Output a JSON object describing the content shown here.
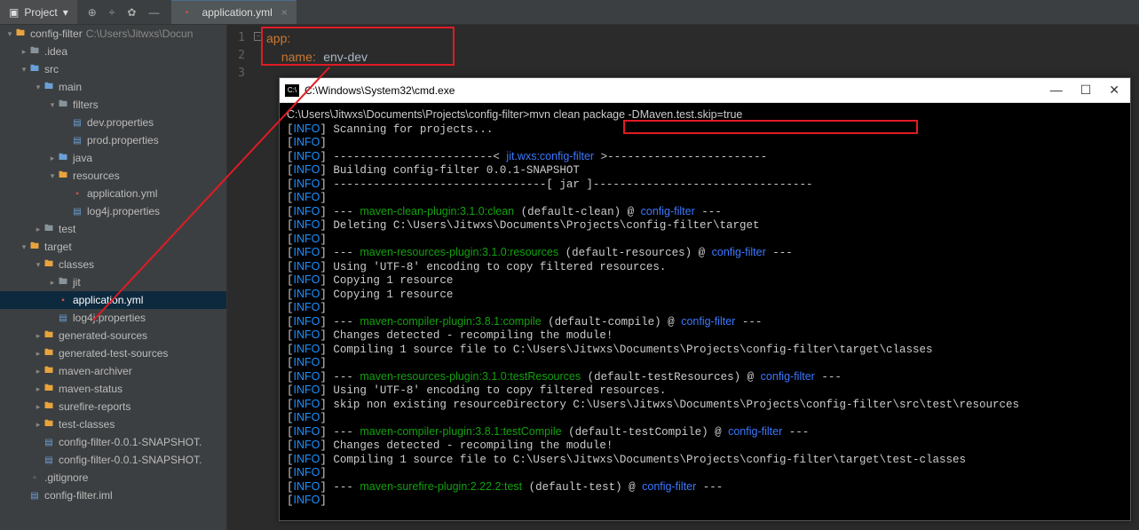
{
  "top": {
    "project": "Project",
    "tab": "application.yml"
  },
  "tree": [
    {
      "d": 0,
      "a": "▾",
      "ic": "dir-m",
      "t": "config-filter",
      "path": "C:\\Users\\Jitwxs\\Docun"
    },
    {
      "d": 1,
      "a": "▸",
      "ic": "dir",
      "t": ".idea"
    },
    {
      "d": 1,
      "a": "▾",
      "ic": "dir-b",
      "t": "src"
    },
    {
      "d": 2,
      "a": "▾",
      "ic": "dir-b",
      "t": "main"
    },
    {
      "d": 3,
      "a": "▾",
      "ic": "dir",
      "t": "filters"
    },
    {
      "d": 4,
      "a": "",
      "ic": "prop",
      "t": "dev.properties"
    },
    {
      "d": 4,
      "a": "",
      "ic": "prop",
      "t": "prod.properties"
    },
    {
      "d": 3,
      "a": "▸",
      "ic": "dir-b",
      "t": "java"
    },
    {
      "d": 3,
      "a": "▾",
      "ic": "dir-m",
      "t": "resources"
    },
    {
      "d": 4,
      "a": "",
      "ic": "yml",
      "t": "application.yml"
    },
    {
      "d": 4,
      "a": "",
      "ic": "prop",
      "t": "log4j.properties"
    },
    {
      "d": 2,
      "a": "▸",
      "ic": "dir",
      "t": "test"
    },
    {
      "d": 1,
      "a": "▾",
      "ic": "dir-m",
      "t": "target"
    },
    {
      "d": 2,
      "a": "▾",
      "ic": "dir-m",
      "t": "classes"
    },
    {
      "d": 3,
      "a": "▸",
      "ic": "dir",
      "t": "jit"
    },
    {
      "d": 3,
      "a": "",
      "ic": "yml",
      "t": "application.yml",
      "sel": true
    },
    {
      "d": 3,
      "a": "",
      "ic": "prop",
      "t": "log4j.properties"
    },
    {
      "d": 2,
      "a": "▸",
      "ic": "dir-m",
      "t": "generated-sources"
    },
    {
      "d": 2,
      "a": "▸",
      "ic": "dir-m",
      "t": "generated-test-sources"
    },
    {
      "d": 2,
      "a": "▸",
      "ic": "dir-m",
      "t": "maven-archiver"
    },
    {
      "d": 2,
      "a": "▸",
      "ic": "dir-m",
      "t": "maven-status"
    },
    {
      "d": 2,
      "a": "▸",
      "ic": "dir-m",
      "t": "surefire-reports"
    },
    {
      "d": 2,
      "a": "▸",
      "ic": "dir-m",
      "t": "test-classes"
    },
    {
      "d": 2,
      "a": "",
      "ic": "prop",
      "t": "config-filter-0.0.1-SNAPSHOT."
    },
    {
      "d": 2,
      "a": "",
      "ic": "prop",
      "t": "config-filter-0.0.1-SNAPSHOT."
    },
    {
      "d": 1,
      "a": "",
      "ic": "file",
      "t": ".gitignore"
    },
    {
      "d": 1,
      "a": "",
      "ic": "prop",
      "t": "config-filter.iml"
    }
  ],
  "code": {
    "k1": "app",
    "k2": "name",
    "v": "env-dev"
  },
  "cmd_title": "C:\\Windows\\System32\\cmd.exe",
  "cmd_prompt": "C:\\Users\\Jitwxs\\Documents\\Projects\\config-filter>",
  "cmd_cmd": "mvn clean package -DMaven.test.skip=true",
  "L": {
    "scan": "Scanning for projects...",
    "dash1": "------------------------< ",
    "jitcfg": "jit.wxs:config-filter",
    "dash1b": " >------------------------",
    "build": "Building config-filter 0.0.1-SNAPSHOT",
    "jarline": "--------------------------------[ jar ]---------------------------------",
    "clean": "maven-clean-plugin:3.1.0:clean",
    "cleanT": " (default-clean) @ ",
    "cf": "config-filter",
    "dash": " ---",
    "del": "Deleting C:\\Users\\Jitwxs\\Documents\\Projects\\config-filter\\target",
    "res": "maven-resources-plugin:3.1.0:resources",
    "resT": " (default-resources) @ ",
    "utf": "Using 'UTF-8' encoding to copy filtered resources.",
    "cp1": "Copying 1 resource",
    "comp": "maven-compiler-plugin:3.8.1:compile",
    "compT": " (default-compile) @ ",
    "chg": "Changes detected - recompiling the module!",
    "c1": "Compiling 1 source file to C:\\Users\\Jitwxs\\Documents\\Projects\\config-filter\\target\\classes",
    "tres": "maven-resources-plugin:3.1.0:testResources",
    "tresT": " (default-testResources) @ ",
    "skip": "skip non existing resourceDirectory C:\\Users\\Jitwxs\\Documents\\Projects\\config-filter\\src\\test\\resources",
    "tcomp": "maven-compiler-plugin:3.8.1:testCompile",
    "tcompT": " (default-testCompile) @ ",
    "c2": "Compiling 1 source file to C:\\Users\\Jitwxs\\Documents\\Projects\\config-filter\\target\\test-classes",
    "sure": "maven-surefire-plugin:2.22.2:test",
    "sureT": " (default-test) @ "
  }
}
